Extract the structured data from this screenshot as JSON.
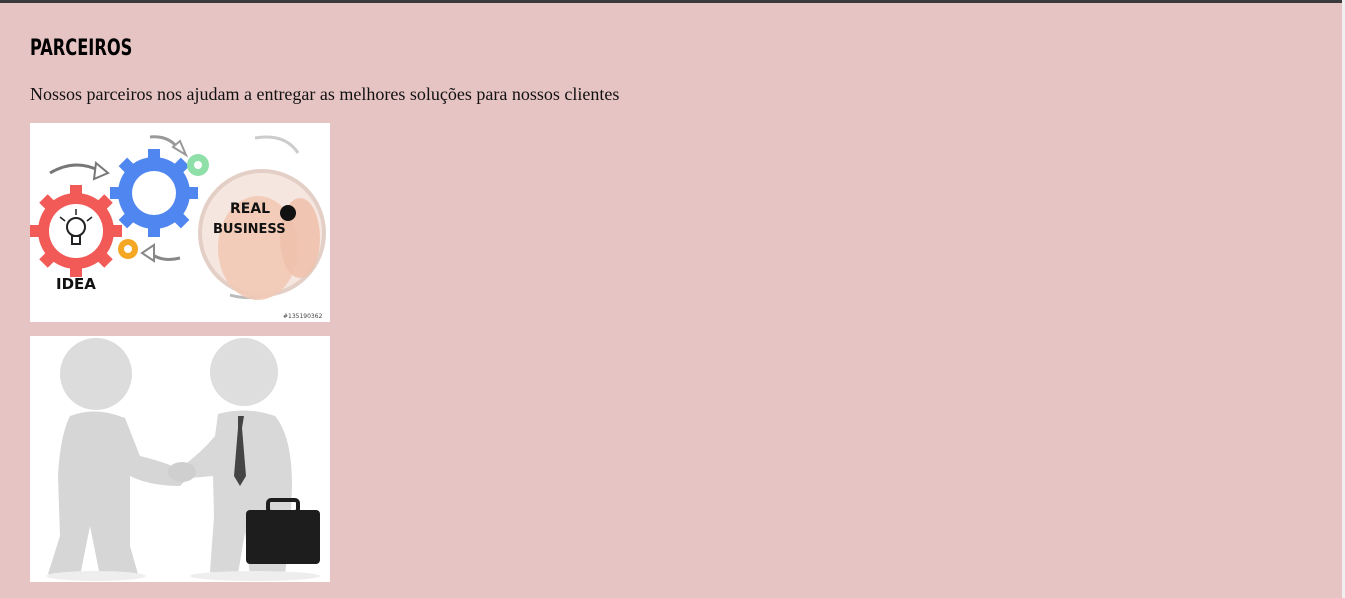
{
  "section": {
    "title": "PARCEIROS",
    "subtitle": "Nossos parceiros nos ajudam a entregar as melhores soluções para nossos clientes"
  },
  "images": {
    "image1": {
      "label_idea": "IDEA",
      "label_real": "REAL",
      "label_business": "BUSINESS",
      "stock_id": "#135190362"
    },
    "image2": {}
  },
  "colors": {
    "background": "#e6c4c3",
    "topbar": "#3a3a3a",
    "gear_red": "#f25a57",
    "gear_blue": "#4f86f0",
    "gear_orange": "#f5a623",
    "gear_green": "#8fe0a8"
  }
}
